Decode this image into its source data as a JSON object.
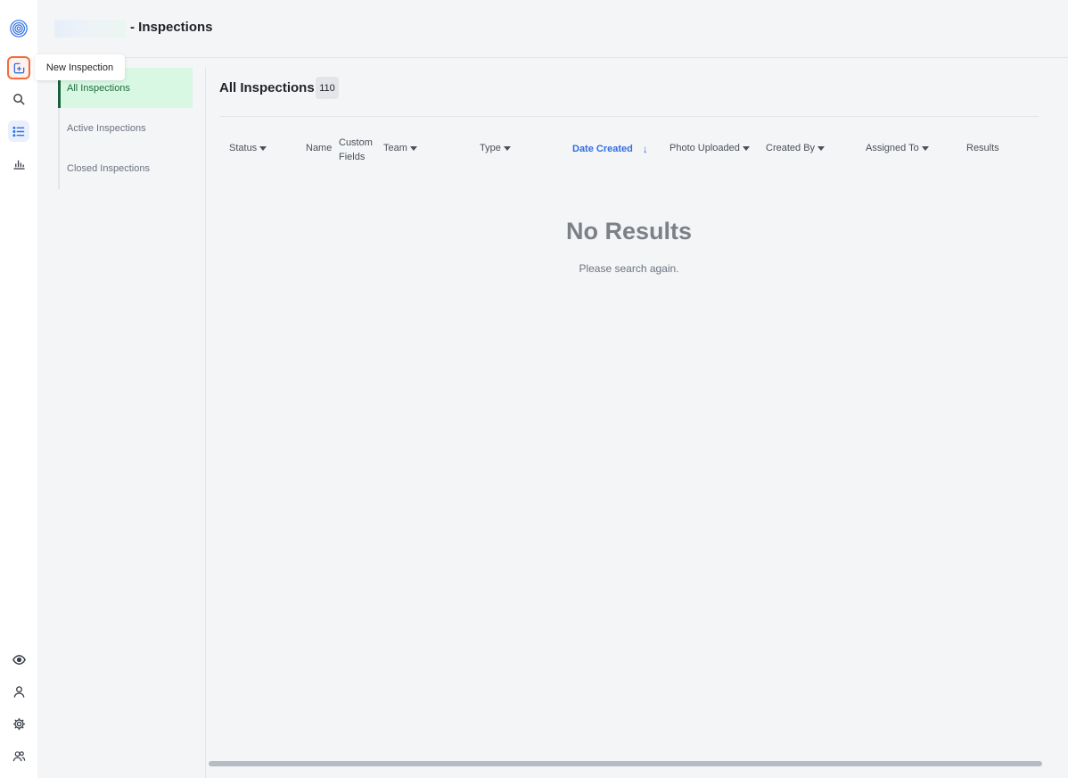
{
  "header": {
    "title": "- Inspections"
  },
  "tooltip": {
    "label": "New Inspection"
  },
  "subnav": {
    "items": [
      {
        "label": "All Inspections"
      },
      {
        "label": "Active Inspections"
      },
      {
        "label": "Closed Inspections"
      }
    ]
  },
  "main": {
    "title": "All Inspections",
    "count": "110",
    "columns": {
      "status": "Status",
      "name": "Name",
      "custom_fields": "Custom Fields",
      "team": "Team",
      "type": "Type",
      "date_created": "Date Created",
      "photo_uploaded": "Photo Uploaded",
      "created_by": "Created By",
      "assigned_to": "Assigned To",
      "results": "Results"
    },
    "sort_arrow": "↓",
    "empty_title": "No Results",
    "empty_sub": "Please search again."
  },
  "colors": {
    "accent": "#2f6fe0",
    "highlight": "#f36b3b",
    "active_nav_bg": "#d9f8e4",
    "active_nav_text": "#1c6b3b"
  },
  "icons": [
    "logo-icon",
    "new-inspection-icon",
    "search-icon",
    "list-icon",
    "chart-icon",
    "eye-icon",
    "user-icon",
    "gear-icon",
    "team-icon"
  ]
}
